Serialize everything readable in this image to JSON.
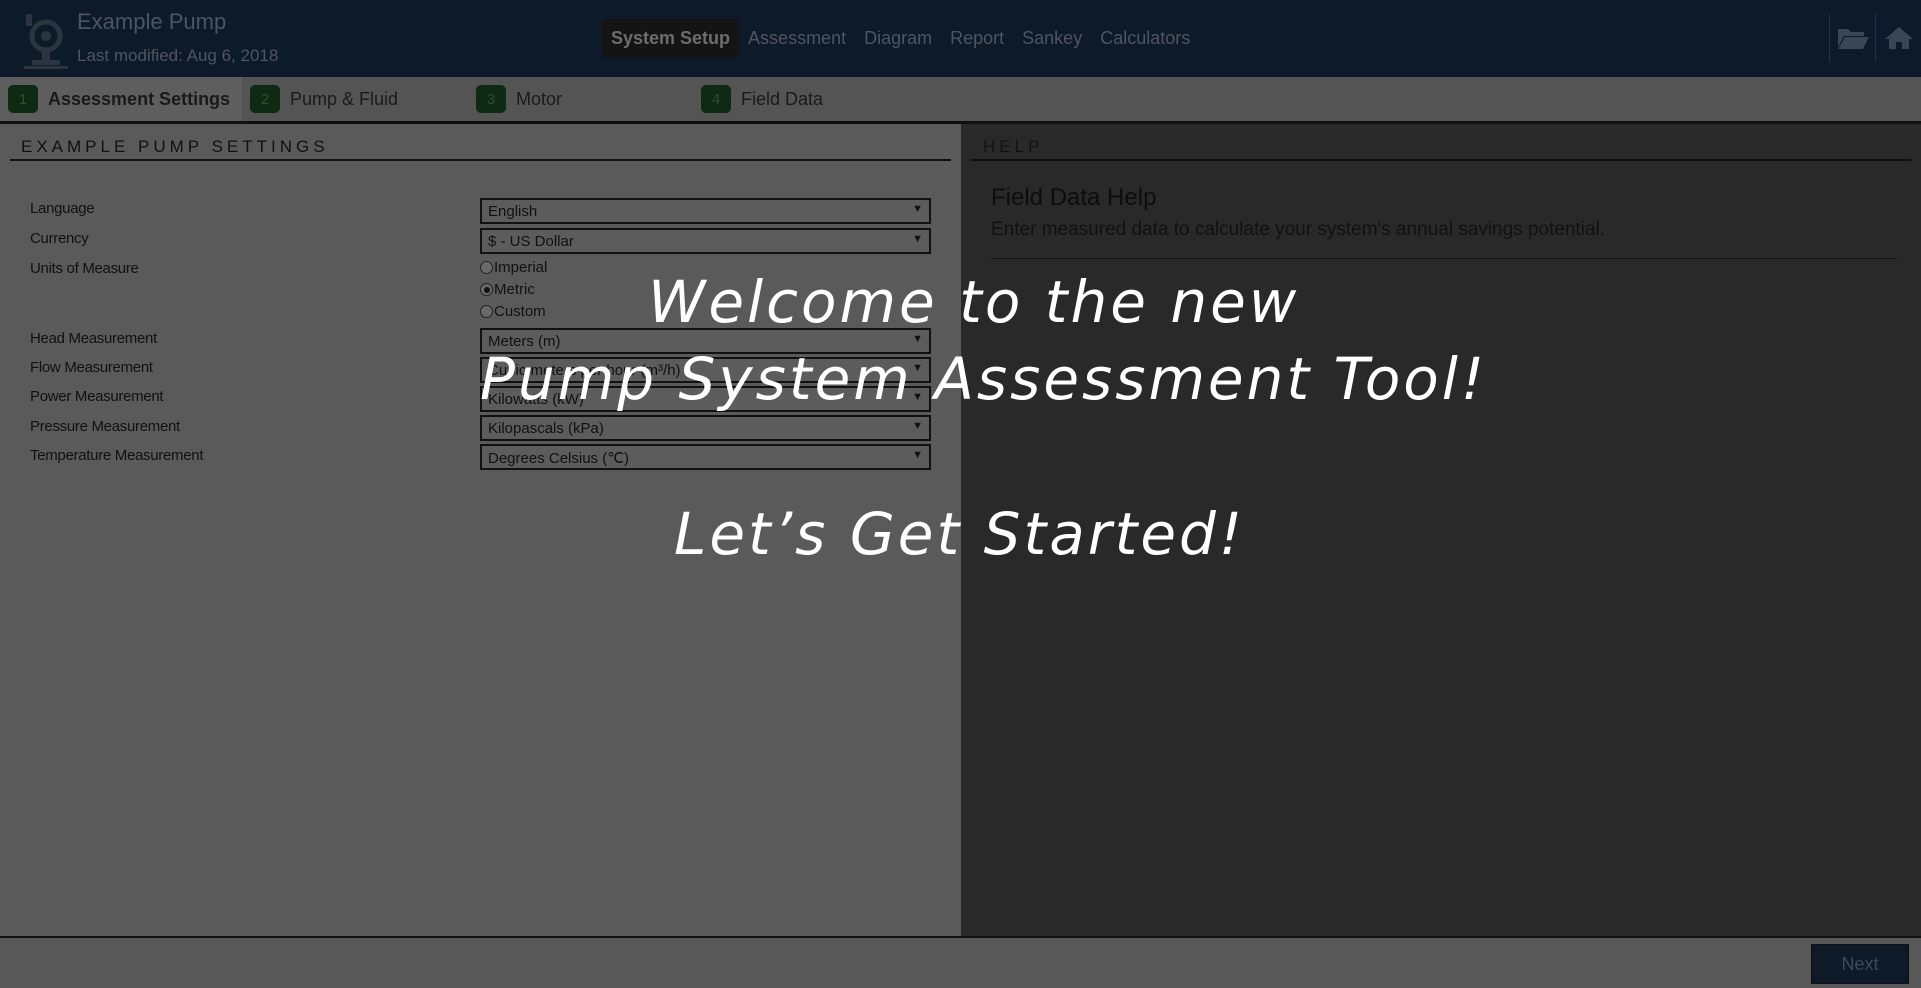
{
  "header": {
    "title": "Example Pump",
    "modified": "Last modified: Aug 6, 2018",
    "nav": [
      "System Setup",
      "Assessment",
      "Diagram",
      "Report",
      "Sankey",
      "Calculators"
    ],
    "active_nav": "System Setup",
    "icons": [
      "folder-open-icon",
      "home-icon"
    ]
  },
  "steps": [
    {
      "num": "1",
      "label": "Assessment Settings",
      "active": true
    },
    {
      "num": "2",
      "label": "Pump & Fluid",
      "active": false
    },
    {
      "num": "3",
      "label": "Motor",
      "active": false
    },
    {
      "num": "4",
      "label": "Field Data",
      "active": false
    }
  ],
  "settings": {
    "heading": "EXAMPLE PUMP SETTINGS",
    "language": {
      "label": "Language",
      "value": "English"
    },
    "currency": {
      "label": "Currency",
      "value": "$ - US Dollar"
    },
    "units": {
      "label": "Units of Measure",
      "options": [
        "Imperial",
        "Metric",
        "Custom"
      ],
      "selected": "Metric"
    },
    "head": {
      "label": "Head Measurement",
      "value": "Meters (m)"
    },
    "flow": {
      "label": "Flow Measurement",
      "value": "Cubic meters per hour (m³/h)"
    },
    "power": {
      "label": "Power Measurement",
      "value": "Kilowatts (kW)"
    },
    "pressure": {
      "label": "Pressure Measurement",
      "value": "Kilopascals (kPa)"
    },
    "temperature": {
      "label": "Temperature Measurement",
      "value": "Degrees Celsius (℃)"
    }
  },
  "help": {
    "heading": "HELP",
    "title": "Field Data Help",
    "text": "Enter measured data to calculate your system's annual savings potential."
  },
  "footer": {
    "next_label": "Next"
  },
  "overlay": {
    "line1": "Welcome to the new",
    "line2": "Pump System Assessment Tool!",
    "line3": "Let’s Get Started!"
  },
  "colors": {
    "header_bg": "#0d1a2a",
    "step_badge": "#0f2a12",
    "overlay_text": "#ffffff"
  }
}
